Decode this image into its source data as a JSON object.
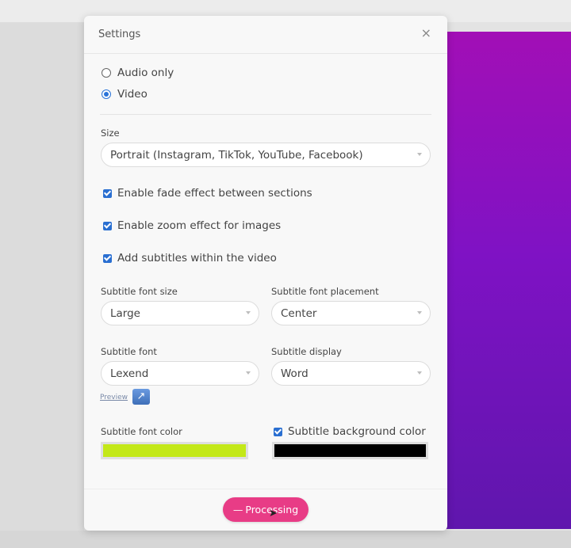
{
  "modal": {
    "title": "Settings",
    "close_glyph": "×"
  },
  "output_mode": {
    "options": [
      {
        "label": "Audio only",
        "checked": false
      },
      {
        "label": "Video",
        "checked": true
      }
    ]
  },
  "size": {
    "label": "Size",
    "value": "Portrait (Instagram, TikTok, YouTube, Facebook)"
  },
  "effects": [
    {
      "label": "Enable fade effect between sections",
      "checked": true
    },
    {
      "label": "Enable zoom effect for images",
      "checked": true
    },
    {
      "label": "Add subtitles within the video",
      "checked": true
    }
  ],
  "subtitle_font_size": {
    "label": "Subtitle font size",
    "value": "Large"
  },
  "subtitle_font_placement": {
    "label": "Subtitle font placement",
    "value": "Center"
  },
  "subtitle_font": {
    "label": "Subtitle font",
    "value": "Lexend"
  },
  "subtitle_display": {
    "label": "Subtitle display",
    "value": "Word"
  },
  "preview": {
    "label": "Preview",
    "icon": "external-link-icon"
  },
  "subtitle_font_color": {
    "label": "Subtitle font color",
    "color": "#c3e818"
  },
  "subtitle_background_color": {
    "label": "Subtitle background color",
    "checked": true,
    "color": "#000000"
  },
  "process_button": {
    "label": "Processing",
    "icon": "spinner-icon"
  },
  "colors": {
    "accent_blue": "#2a6fd1",
    "process_pink": "#e83c86",
    "panel_purple": "#8a12c0"
  }
}
